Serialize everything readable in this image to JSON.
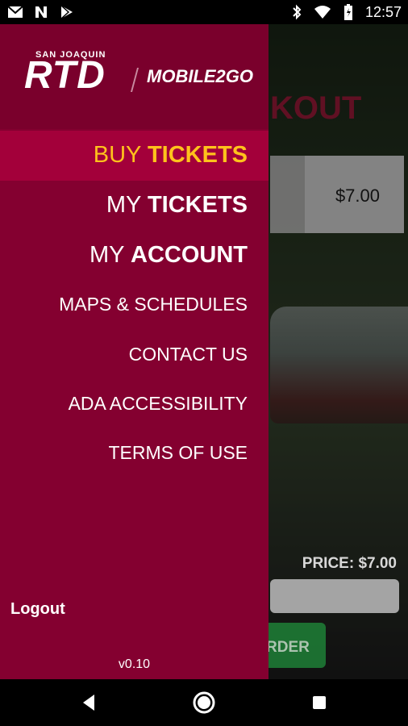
{
  "status_bar": {
    "time": "12:57",
    "left_icons": [
      "gmail-icon",
      "n-icon",
      "play-store-icon"
    ],
    "right_icons": [
      "bluetooth-icon",
      "wifi-icon",
      "battery-icon"
    ]
  },
  "background_screen": {
    "title_fragment": "KOUT",
    "price_value": "$7.00",
    "price_label": "PRICE: $7.00",
    "order_button_fragment": "RDER"
  },
  "drawer": {
    "logo_small": "SAN JOAQUIN",
    "logo_big": "RTD",
    "logo_secondary": "MOBILE2GO",
    "menu": {
      "buy_tickets_1": "BUY ",
      "buy_tickets_2": "TICKETS",
      "my_tickets_1": "MY ",
      "my_tickets_2": "TICKETS",
      "my_account_1": "MY ",
      "my_account_2": "ACCOUNT",
      "maps": "MAPS & SCHEDULES",
      "contact": "CONTACT US",
      "ada": "ADA ACCESSIBILITY",
      "terms": "TERMS OF USE"
    },
    "logout": "Logout",
    "version": "v0.10"
  },
  "colors": {
    "drawer_bg": "#840030",
    "active_item_bg": "#a3003a",
    "active_item_text": "#ffc21c"
  },
  "nav_bar": {
    "icons": [
      "back-icon",
      "home-icon",
      "recents-icon"
    ]
  }
}
